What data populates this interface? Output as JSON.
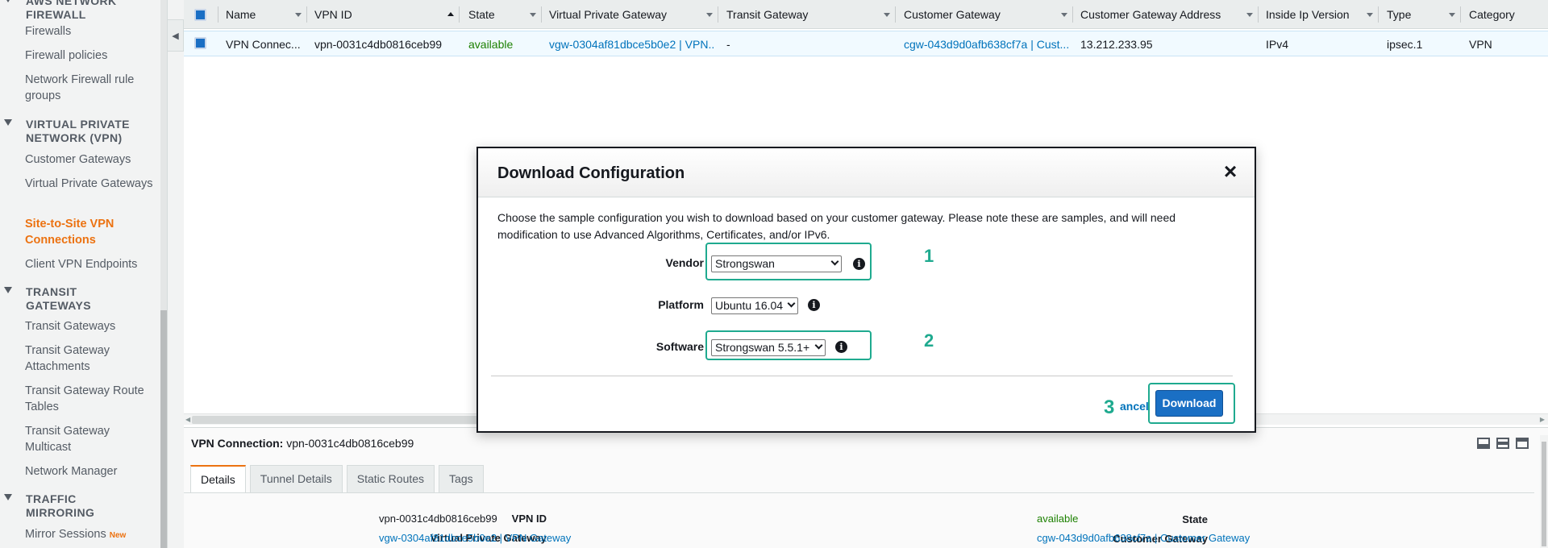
{
  "sidebar": {
    "sections": [
      {
        "title_lines": [
          "AWS NETWORK",
          "FIREWALL"
        ]
      },
      {
        "title_lines": [
          "VIRTUAL PRIVATE",
          "NETWORK (VPN)"
        ]
      },
      {
        "title_lines": [
          "TRANSIT",
          "GATEWAYS"
        ]
      },
      {
        "title_lines": [
          "TRAFFIC",
          "MIRRORING"
        ]
      }
    ],
    "items": [
      {
        "label": "Firewalls"
      },
      {
        "label": "Firewall policies"
      },
      {
        "label": "Network Firewall rule groups"
      },
      {
        "label": "Customer Gateways"
      },
      {
        "label": "Virtual Private Gateways"
      },
      {
        "label": "Site-to-Site VPN Connections"
      },
      {
        "label": "Client VPN Endpoints"
      },
      {
        "label": "Transit Gateways"
      },
      {
        "label": "Transit Gateway Attachments"
      },
      {
        "label": "Transit Gateway Route Tables"
      },
      {
        "label": "Transit Gateway Multicast"
      },
      {
        "label": "Network Manager"
      },
      {
        "label": "Mirror Sessions",
        "badge": "New"
      }
    ]
  },
  "grid": {
    "columns": [
      "Name",
      "VPN ID",
      "State",
      "Virtual Private Gateway",
      "Transit Gateway",
      "Customer Gateway",
      "Customer Gateway Address",
      "Inside Ip Version",
      "Type",
      "Category"
    ],
    "row": {
      "name": "VPN Connec...",
      "vpn_id": "vpn-0031c4db0816ceb99",
      "state": "available",
      "vgw": "vgw-0304af81dbce5b0e2 | VPN...",
      "tgw": "-",
      "cgw": "cgw-043d9d0afb638cf7a | Cust...",
      "cgw_address": "13.212.233.95",
      "ip_version": "IPv4",
      "type": "ipsec.1",
      "category": "VPN"
    }
  },
  "detail": {
    "title_label": "VPN Connection:",
    "title_value": "vpn-0031c4db0816ceb99",
    "tabs": [
      "Details",
      "Tunnel Details",
      "Static Routes",
      "Tags"
    ],
    "props": {
      "vpn_id_label": "VPN ID",
      "vpn_id_value": "vpn-0031c4db0816ceb99",
      "vgw_label": "Virtual Private Gateway",
      "vgw_value": "vgw-0304af81dbce5b0e2 | VPN Gateway",
      "state_label": "State",
      "state_value": "available",
      "cgw_label": "Customer Gateway",
      "cgw_value": "cgw-043d9d0afb638cf7a | Customer Gateway"
    }
  },
  "modal": {
    "title": "Download Configuration",
    "close_glyph": "×",
    "description": "Choose the sample configuration you wish to download based on your customer gateway. Please note these are samples, and will need modification to use Advanced Algorithms, Certificates, and/or IPv6.",
    "vendor_label": "Vendor",
    "vendor_value": "Strongswan",
    "platform_label": "Platform",
    "platform_value": "Ubuntu 16.04",
    "software_label": "Software",
    "software_value": "Strongswan 5.5.1+",
    "step1": "1",
    "step2": "2",
    "step3": "3",
    "cancel_label": "ancel",
    "download_label": "Download",
    "info_glyph": "i"
  },
  "colors": {
    "accent": "#ec7211",
    "link": "#0073bb",
    "primary_button": "#1a6fc4",
    "annotation": "#1faa8f",
    "available": "#1d8102"
  }
}
